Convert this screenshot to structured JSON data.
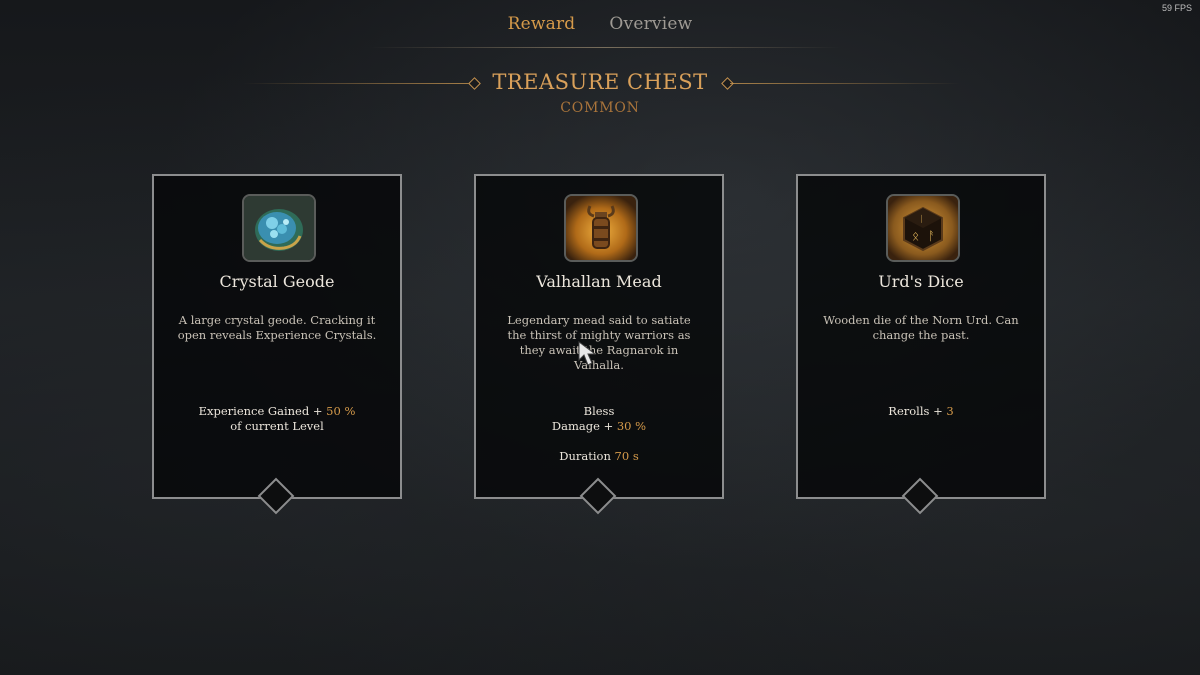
{
  "hud": {
    "fps": "59 FPS"
  },
  "tabs": [
    {
      "label": "Reward",
      "active": true
    },
    {
      "label": "Overview",
      "active": false
    }
  ],
  "header": {
    "title": "TREASURE CHEST",
    "rarity": "COMMON"
  },
  "colors": {
    "accent": "#d59a4a",
    "title": "#d9a05a",
    "card_border": "#8c8d8e"
  },
  "cards": [
    {
      "name": "Crystal Geode",
      "icon": "crystal-geode-icon",
      "description": "A large crystal geode. Cracking it open reveals Experience Crystals.",
      "stat1_prefix": "Experience Gained + ",
      "stat1_value": "50 %",
      "stat1_suffix": "of current Level"
    },
    {
      "name": "Valhallan Mead",
      "icon": "mead-lantern-icon",
      "description": "Legendary mead said to satiate the thirst of mighty warriors as they await the Ragnarok in Valhalla.",
      "stat_title": "Bless",
      "stat1_prefix": "Damage + ",
      "stat1_value": "30 %",
      "stat2_prefix": "Duration ",
      "stat2_value": "70 s"
    },
    {
      "name": "Urd's Dice",
      "icon": "rune-dice-icon",
      "description": "Wooden die of the Norn Urd. Can change the past.",
      "stat1_prefix": "Rerolls + ",
      "stat1_value": "3"
    }
  ]
}
